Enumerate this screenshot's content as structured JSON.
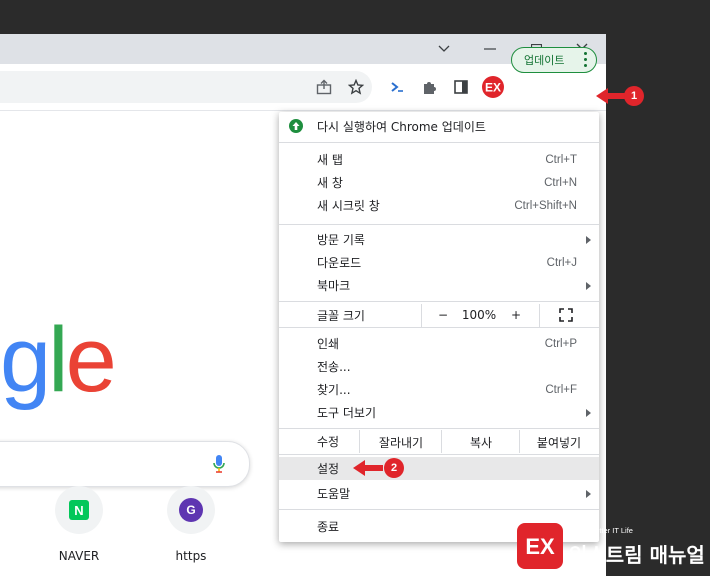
{
  "google_logo": {
    "g1": "g",
    "l": "l",
    "e": "e"
  },
  "update_button": {
    "label": "업데이트"
  },
  "menu": {
    "update_item": "다시 실행하여 Chrome 업데이트",
    "group1": [
      {
        "label": "새 탭",
        "shortcut": "Ctrl+T"
      },
      {
        "label": "새 창",
        "shortcut": "Ctrl+N"
      },
      {
        "label": "새 시크릿 창",
        "shortcut": "Ctrl+Shift+N"
      }
    ],
    "group2": [
      {
        "label": "방문 기록",
        "shortcut": ""
      },
      {
        "label": "다운로드",
        "shortcut": "Ctrl+J"
      },
      {
        "label": "북마크",
        "shortcut": ""
      }
    ],
    "zoom": {
      "label": "글꼴 크기",
      "minus": "−",
      "value": "100%",
      "plus": "+"
    },
    "group3": [
      {
        "label": "인쇄",
        "shortcut": "Ctrl+P"
      },
      {
        "label": "전송...",
        "shortcut": ""
      },
      {
        "label": "찾기...",
        "shortcut": "Ctrl+F"
      },
      {
        "label": "도구 더보기",
        "shortcut": ""
      }
    ],
    "edit": {
      "label": "수정",
      "cut": "잘라내기",
      "copy": "복사",
      "paste": "붙여넣기"
    },
    "settings": "설정",
    "help": "도움말",
    "exit": "종료"
  },
  "shortcuts": [
    {
      "label": "NAVER",
      "icon_text": "N",
      "color": "#03c75a"
    },
    {
      "label": "https",
      "icon_text": "G",
      "color": "#5e35b1"
    }
  ],
  "annotations": {
    "badge1": "1",
    "badge2": "2"
  },
  "watermark": {
    "tagline": "More Better IT Life",
    "name": "익스트림 매뉴얼"
  },
  "colors": {
    "accent_red": "#e0252b",
    "update_green": "#137333",
    "google_blue": "#4285f4",
    "google_green": "#34a853",
    "google_red": "#ea4335"
  }
}
